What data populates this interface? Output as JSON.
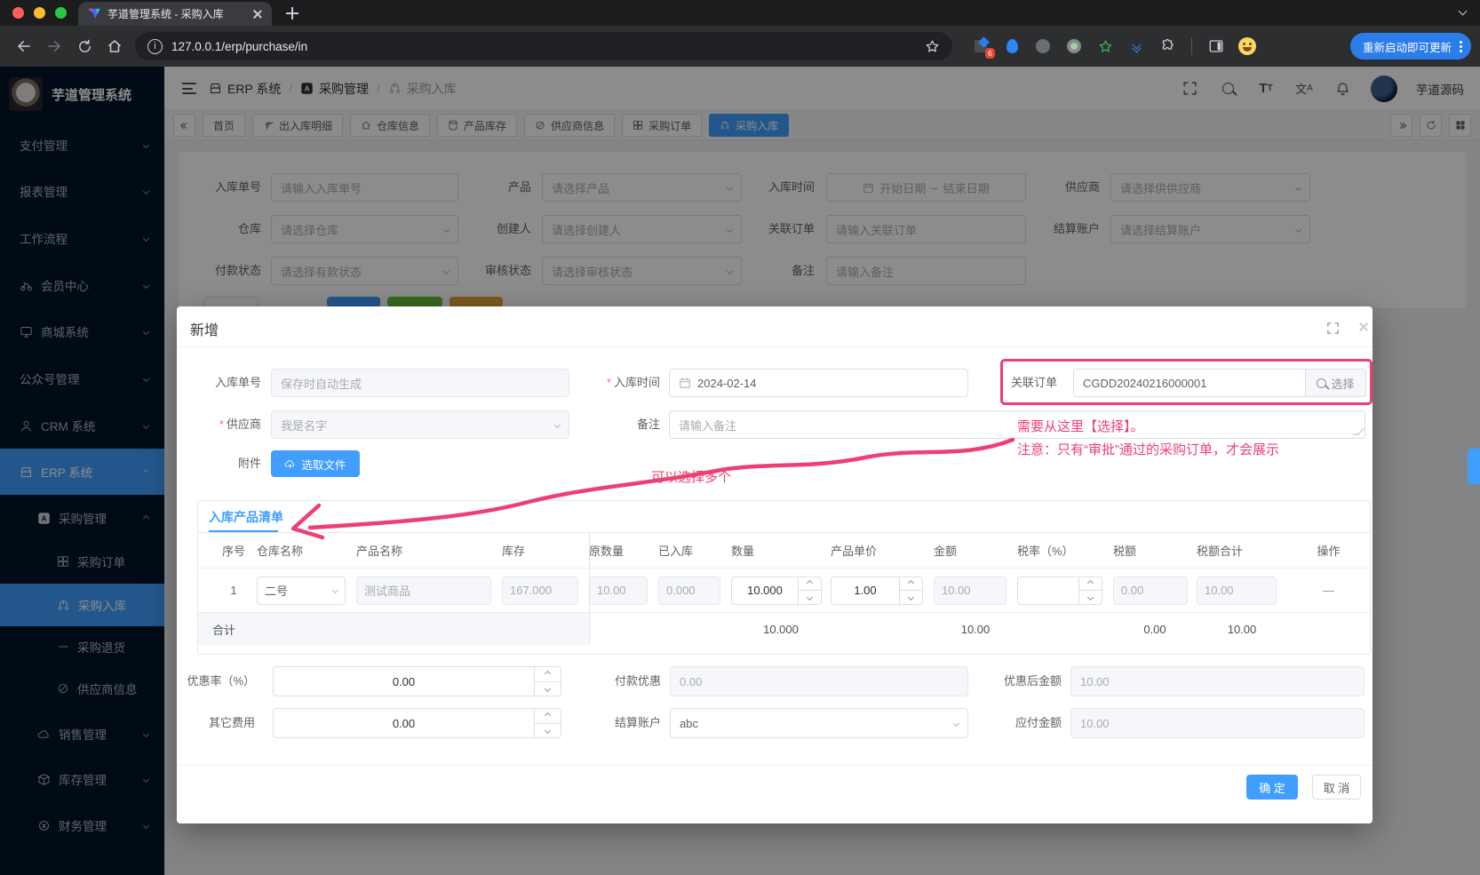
{
  "browser": {
    "tab_title": "芋道管理系统 - 采购入库",
    "url": "127.0.0.1/erp/purchase/in",
    "update_button": "重新启动即可更新",
    "extension_badge": "6"
  },
  "sidebar": {
    "logo_title": "芋道管理系统",
    "items": [
      {
        "label": "支付管理"
      },
      {
        "label": "报表管理"
      },
      {
        "label": "工作流程"
      },
      {
        "label": "会员中心"
      },
      {
        "label": "商城系统"
      },
      {
        "label": "公众号管理"
      },
      {
        "label": "CRM 系统"
      },
      {
        "label": "ERP 系统"
      },
      {
        "label": "采购管理"
      },
      {
        "label": "采购订单"
      },
      {
        "label": "采购入库"
      },
      {
        "label": "采购退货"
      },
      {
        "label": "供应商信息"
      },
      {
        "label": "销售管理"
      },
      {
        "label": "库存管理"
      },
      {
        "label": "财务管理"
      }
    ]
  },
  "header": {
    "breadcrumb": [
      {
        "label": "ERP 系统"
      },
      {
        "label": "采购管理"
      },
      {
        "label": "采购入库"
      }
    ],
    "username": "芋道源码"
  },
  "tabbar": {
    "tabs": [
      {
        "label": "首页"
      },
      {
        "label": "出入库明细"
      },
      {
        "label": "仓库信息"
      },
      {
        "label": "产品库存"
      },
      {
        "label": "供应商信息"
      },
      {
        "label": "采购订单"
      },
      {
        "label": "采购入库"
      }
    ]
  },
  "filter": {
    "fields": [
      {
        "label": "入库单号",
        "placeholder": "请输入入库单号"
      },
      {
        "label": "产品",
        "placeholder": "请选择产品"
      },
      {
        "label": "入库时间",
        "start": "开始日期",
        "sep": "–",
        "end": "结束日期"
      },
      {
        "label": "供应商",
        "placeholder": "请选择供供应商"
      },
      {
        "label": "仓库",
        "placeholder": "请选择仓库"
      },
      {
        "label": "创建人",
        "placeholder": "请选择创建人"
      },
      {
        "label": "关联订单",
        "placeholder": "请输入关联订单"
      },
      {
        "label": "结算账户",
        "placeholder": "请选择结算账户"
      },
      {
        "label": "付款状态",
        "placeholder": "请选择有款状态"
      },
      {
        "label": "审核状态",
        "placeholder": "请选择审核状态"
      },
      {
        "label": "备注",
        "placeholder": "请输入备注"
      }
    ]
  },
  "modal": {
    "title": "新增",
    "order_no": {
      "label": "入库单号",
      "placeholder": "保存时自动生成"
    },
    "in_time": {
      "label": "入库时间",
      "value": "2024-02-14"
    },
    "related_order": {
      "label": "关联订单",
      "value": "CGDD20240216000001",
      "select_button": "选择"
    },
    "supplier": {
      "label": "供应商",
      "value": "我是名字"
    },
    "remark": {
      "label": "备注",
      "placeholder": "请输入备注"
    },
    "attachment": {
      "label": "附件",
      "button": "选取文件"
    },
    "tab": "入库产品清单",
    "table": {
      "headers": [
        "序号",
        "仓库名称",
        "产品名称",
        "库存",
        "原数量",
        "已入库",
        "数量",
        "产品单价",
        "金额",
        "税率（%）",
        "税额",
        "税额合计",
        "操作"
      ],
      "row": {
        "index": "1",
        "warehouse": "二号",
        "product": "测试商品",
        "stock": "167.000",
        "original_qty": "10.00",
        "received_qty": "0.000",
        "qty": "10.000",
        "unit_price": "1.00",
        "amount": "10.00",
        "tax_rate": "",
        "tax_amount": "0.00",
        "tax_total": "10.00",
        "action": "—"
      },
      "total": {
        "label": "合计",
        "qty": "10.000",
        "amount": "10.00",
        "tax_amount": "0.00",
        "tax_total": "10.00"
      }
    },
    "discount_rate": {
      "label": "优惠率（%）",
      "value": "0.00"
    },
    "payment_discount": {
      "label": "付款优惠",
      "value": "0.00"
    },
    "amount_after_discount": {
      "label": "优惠后金额",
      "value": "10.00"
    },
    "other_fee": {
      "label": "其它费用",
      "value": "0.00"
    },
    "settlement_account": {
      "label": "结算账户",
      "value": "abc"
    },
    "payable_amount": {
      "label": "应付金额",
      "value": "10.00"
    },
    "confirm_button": "确 定",
    "cancel_button": "取 消"
  },
  "annotations": {
    "note_line1": "需要从这里【选择】。",
    "note_line2": "注意：只有“审批”通过的采购订单，才会展示",
    "note_multi": "可以选择多个",
    "color": "#ee3f72"
  },
  "colors": {
    "primary": "#409eff",
    "sidebar_bg": "#001529"
  }
}
